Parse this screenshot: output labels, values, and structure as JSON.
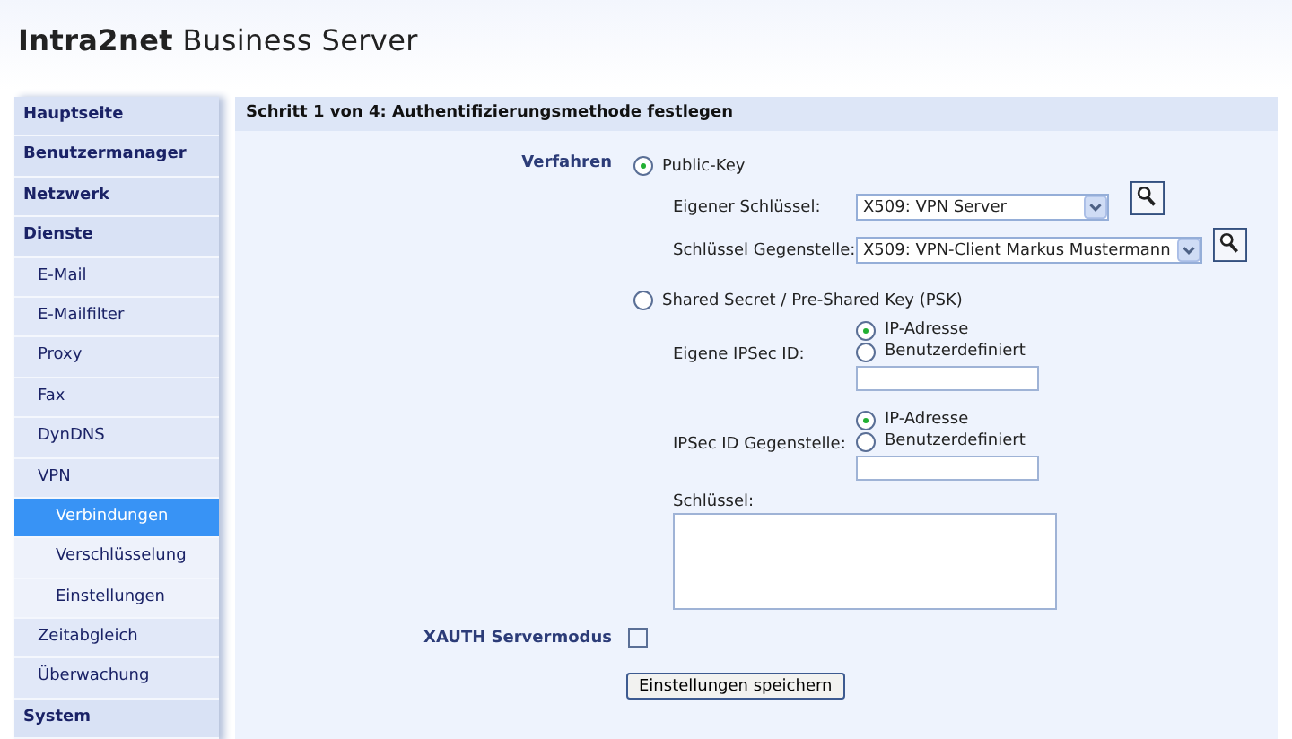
{
  "header": {
    "brand_strong": "Intra2net",
    "brand_rest": "Business Server"
  },
  "sidebar": {
    "items": [
      {
        "label": "Hauptseite",
        "selected": false
      },
      {
        "label": "Benutzermanager",
        "selected": false
      },
      {
        "label": "Netzwerk",
        "selected": false
      },
      {
        "label": "Dienste",
        "selected": false,
        "children": [
          {
            "label": "E-Mail",
            "selected": false
          },
          {
            "label": "E-Mailfilter",
            "selected": false
          },
          {
            "label": "Proxy",
            "selected": false
          },
          {
            "label": "Fax",
            "selected": false
          },
          {
            "label": "DynDNS",
            "selected": false
          },
          {
            "label": "VPN",
            "selected": false,
            "children": [
              {
                "label": "Verbindungen",
                "selected": true
              },
              {
                "label": "Verschlüsselung",
                "selected": false
              },
              {
                "label": "Einstellungen",
                "selected": false
              }
            ]
          },
          {
            "label": "Zeitabgleich",
            "selected": false
          },
          {
            "label": "Überwachung",
            "selected": false
          }
        ]
      },
      {
        "label": "System",
        "selected": false
      }
    ]
  },
  "form": {
    "title": "Schritt 1 von 4: Authentifizierungsmethode festlegen",
    "method_label": "Verfahren",
    "methods": [
      {
        "kind": "public_key",
        "label": "Public-Key",
        "selected": true,
        "fields": [
          {
            "label": "Eigener Schlüssel:",
            "value": "X509: VPN Server"
          },
          {
            "label": "Schlüssel Gegenstelle:",
            "value": "X509: VPN-Client Markus Mustermann"
          }
        ]
      },
      {
        "kind": "psk",
        "label": "Shared Secret / Pre-Shared Key (PSK)",
        "selected": false,
        "ids": [
          {
            "label": "Eigene IPSec ID:",
            "options": [
              {
                "label": "IP-Adresse",
                "selected": true
              },
              {
                "label": "Benutzerdefiniert",
                "selected": false
              }
            ]
          },
          {
            "label": "IPSec ID Gegenstelle:",
            "options": [
              {
                "label": "IP-Adresse",
                "selected": true
              },
              {
                "label": "Benutzerdefiniert",
                "selected": false
              }
            ]
          }
        ],
        "key_label": "Schlüssel:"
      }
    ],
    "xauth": {
      "label": "XAUTH Servermodus",
      "checked": false
    },
    "save_button": "Einstellungen speichern"
  }
}
